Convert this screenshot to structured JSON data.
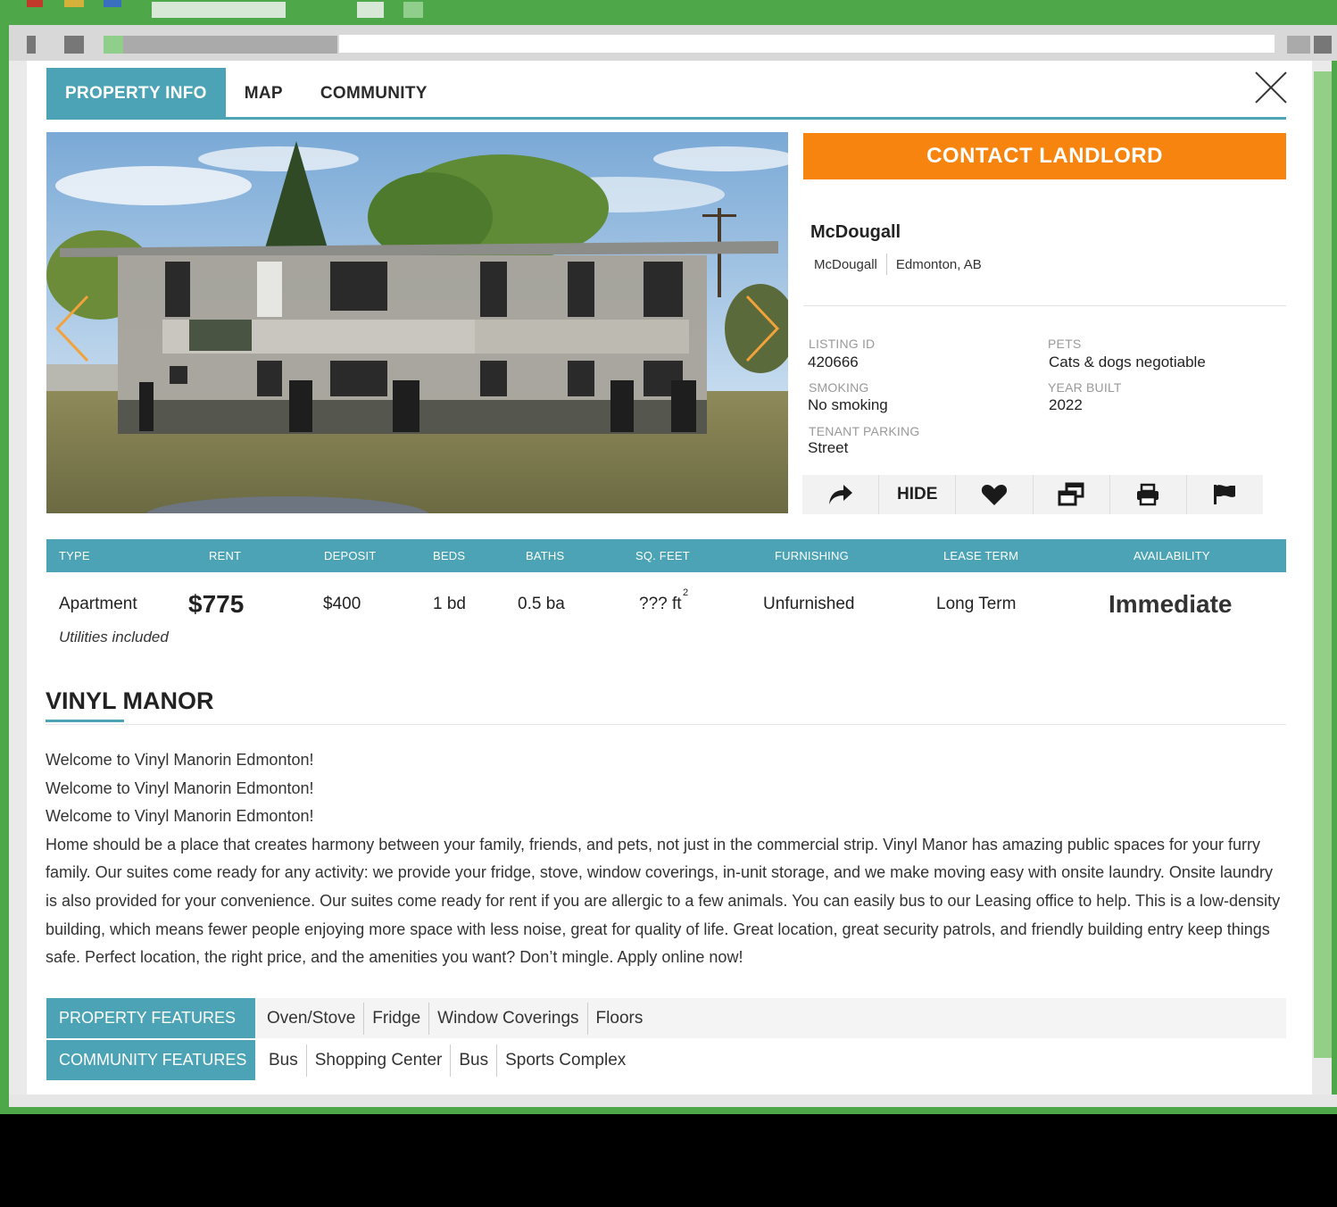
{
  "tabs": [
    "PROPERTY INFO",
    "MAP",
    "COMMUNITY"
  ],
  "contact_label": "CONTACT LANDLORD",
  "location": {
    "title": "McDougall",
    "neighbourhood": "McDougall",
    "city": "Edmonton, AB"
  },
  "specs": {
    "listing_id_label": "LISTING ID",
    "listing_id": "420666",
    "pets_label": "PETS",
    "pets": "Cats & dogs negotiable",
    "smoking_label": "SMOKING",
    "smoking": "No smoking",
    "year_label": "YEAR BUILT",
    "year": "2022",
    "parking_label": "TENANT PARKING",
    "parking": "Street"
  },
  "actions": {
    "hide": "HIDE",
    "icons": [
      "share-icon",
      "heart-icon",
      "compare-icon",
      "print-icon",
      "flag-icon"
    ]
  },
  "table": {
    "headers": [
      "TYPE",
      "RENT",
      "DEPOSIT",
      "BEDS",
      "BATHS",
      "SQ. FEET",
      "FURNISHING",
      "LEASE TERM",
      "AVAILABILITY"
    ],
    "type": "Apartment",
    "rent": "$775",
    "deposit": "$400",
    "beds": "1 bd",
    "baths": "0.5 ba",
    "sqft": "??? ft",
    "sqft_sup": "2",
    "furnishing": "Unfurnished",
    "lease": "Long Term",
    "availability": "Immediate",
    "utilities": "Utilities included"
  },
  "property_name": "VINYL MANOR",
  "description": [
    "Welcome to Vinyl Manorin Edmonton!",
    "Welcome to Vinyl Manorin Edmonton!",
    "Welcome to Vinyl Manorin Edmonton!",
    "Home should be a place that creates harmony between your family, friends, and pets, not just in the commercial strip. Vinyl Manor has amazing public spaces for your furry family. Our suites come ready for any activity: we provide your fridge, stove, window coverings, in-unit storage, and we make moving easy with onsite laundry. Onsite laundry is also provided for your convenience. Our suites come ready for rent if you are allergic to a few animals. You can easily bus to our Leasing office to help. This is a low-density building, which means fewer people enjoying more space with less noise, great for quality of life. Great location, great security patrols, and friendly building entry keep things safe. Perfect location, the right price, and the amenities you want? Don’t mingle. Apply online now!"
  ],
  "property_features": {
    "label": "PROPERTY FEATURES",
    "items": [
      "Oven/Stove",
      "Fridge",
      "Window Coverings",
      "Floors"
    ]
  },
  "community_features": {
    "label": "COMMUNITY FEATURES",
    "items": [
      "Bus",
      "Shopping Center",
      "Bus",
      "Sports Complex"
    ]
  },
  "colors": {
    "accent": "#4ba3b5",
    "contact": "#f7840f",
    "frame": "#4ea84a"
  }
}
